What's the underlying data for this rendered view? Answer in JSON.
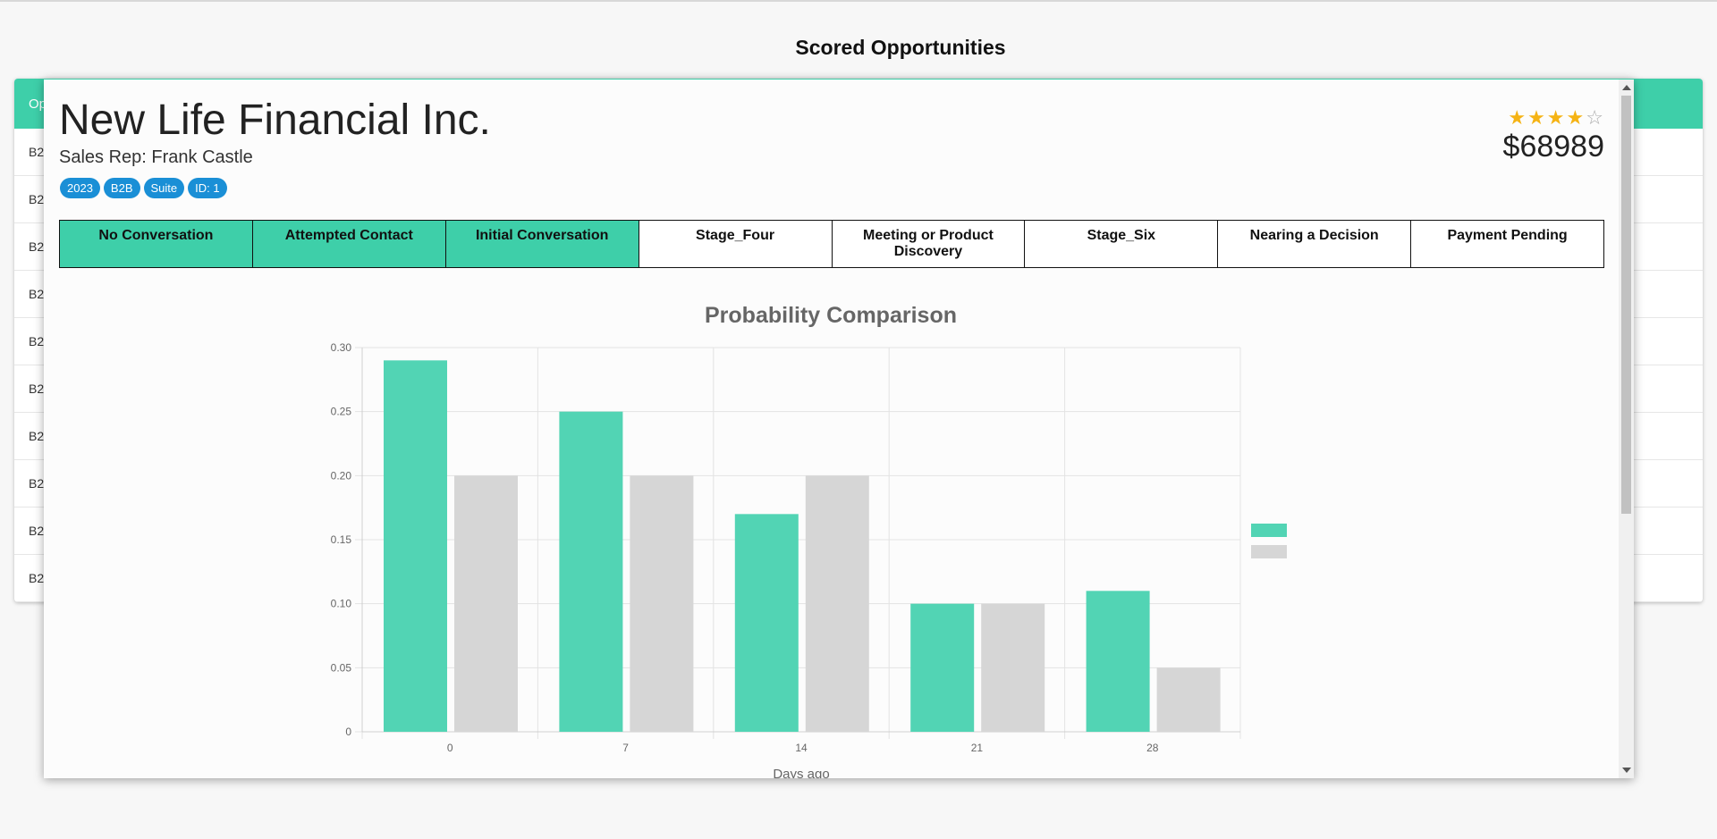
{
  "page": {
    "title": "Scored Opportunities"
  },
  "background_table": {
    "header_text": "Op",
    "rows": [
      "B2",
      "B2",
      "B2",
      "B2",
      "B2",
      "B2",
      "B2",
      "B2",
      "B2",
      "B2"
    ]
  },
  "modal": {
    "company": "New Life Financial Inc.",
    "sales_rep": "Sales Rep: Frank Castle",
    "tags": [
      "2023",
      "B2B",
      "Suite",
      "ID: 1"
    ],
    "rating": 4,
    "rating_max": 5,
    "amount": "$68989",
    "stages": [
      {
        "label": "No Conversation",
        "done": true
      },
      {
        "label": "Attempted Contact",
        "done": true
      },
      {
        "label": "Initial Conversation",
        "done": true
      },
      {
        "label": "Stage_Four",
        "done": false
      },
      {
        "label": "Meeting or Product Discovery",
        "done": false
      },
      {
        "label": "Stage_Six",
        "done": false
      },
      {
        "label": "Nearing a Decision",
        "done": false
      },
      {
        "label": "Payment Pending",
        "done": false
      }
    ]
  },
  "colors": {
    "accent": "#3ecfa9",
    "tag": "#1a8fd6",
    "star": "#f5b314",
    "series_a": "#52d4b4",
    "series_b": "#d6d6d6"
  },
  "chart_data": {
    "type": "bar",
    "title": "Probability Comparison",
    "xlabel": "Days ago",
    "ylabel": "",
    "categories": [
      "0",
      "7",
      "14",
      "21",
      "28"
    ],
    "series": [
      {
        "values": [
          0.29,
          0.25,
          0.17,
          0.1,
          0.11
        ]
      },
      {
        "values": [
          0.2,
          0.2,
          0.2,
          0.1,
          0.05
        ]
      }
    ],
    "ylim": [
      0,
      0.3
    ],
    "yticks": [
      "0",
      "0.05",
      "0.10",
      "0.15",
      "0.20",
      "0.25",
      "0.30"
    ],
    "grid": true,
    "legend": "right"
  }
}
